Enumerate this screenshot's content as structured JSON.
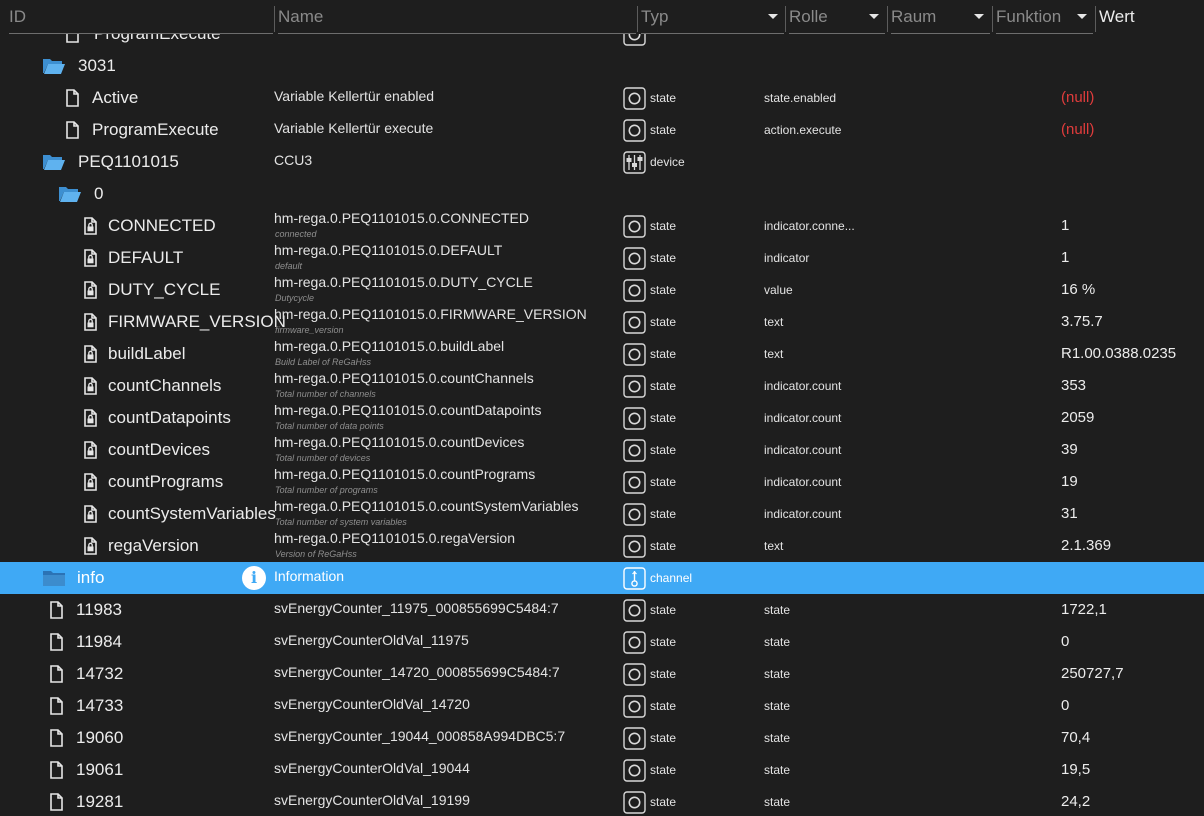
{
  "header": {
    "id": "ID",
    "name": "Name",
    "type": "Typ",
    "role": "Rolle",
    "room": "Raum",
    "function": "Funktion",
    "value": "Wert"
  },
  "colors": {
    "selected": "#3fa9f5",
    "null_value": "#e03c3c",
    "background": "#1e1e1e"
  },
  "rows": [
    {
      "id": "ProgramExecute",
      "name": "",
      "type": "",
      "role": "",
      "value": "",
      "icon": "file-icon"
    },
    {
      "id": "3031",
      "name": "",
      "type": "",
      "role": "",
      "value": "",
      "icon": "folder-open-icon"
    },
    {
      "id": "Active",
      "name": "Variable Kellertür enabled",
      "type": "state",
      "role": "state.enabled",
      "value": "(null)",
      "icon": "file-icon"
    },
    {
      "id": "ProgramExecute",
      "name": "Variable Kellertür execute",
      "type": "state",
      "role": "action.execute",
      "value": "(null)",
      "icon": "file-icon"
    },
    {
      "id": "PEQ1101015",
      "name": "CCU3",
      "type": "device",
      "role": "",
      "value": "",
      "icon": "folder-open-icon"
    },
    {
      "id": "0",
      "name": "",
      "type": "",
      "role": "",
      "value": "",
      "icon": "folder-open-icon"
    },
    {
      "id": "CONNECTED",
      "name": "hm-rega.0.PEQ1101015.0.CONNECTED",
      "desc": "connected",
      "type": "state",
      "role": "indicator.conne...",
      "value": "1",
      "icon": "file-lock-icon"
    },
    {
      "id": "DEFAULT",
      "name": "hm-rega.0.PEQ1101015.0.DEFAULT",
      "desc": "default",
      "type": "state",
      "role": "indicator",
      "value": "1",
      "icon": "file-lock-icon"
    },
    {
      "id": "DUTY_CYCLE",
      "name": "hm-rega.0.PEQ1101015.0.DUTY_CYCLE",
      "desc": "Dutycycle",
      "type": "state",
      "role": "value",
      "value": "16 %",
      "icon": "file-lock-icon"
    },
    {
      "id": "FIRMWARE_VERSION",
      "name": "hm-rega.0.PEQ1101015.0.FIRMWARE_VERSION",
      "desc": "firmware_version",
      "type": "state",
      "role": "text",
      "value": "3.75.7",
      "icon": "file-lock-icon"
    },
    {
      "id": "buildLabel",
      "name": "hm-rega.0.PEQ1101015.0.buildLabel",
      "desc": "Build Label of ReGaHss",
      "type": "state",
      "role": "text",
      "value": "R1.00.0388.0235",
      "icon": "file-lock-icon"
    },
    {
      "id": "countChannels",
      "name": "hm-rega.0.PEQ1101015.0.countChannels",
      "desc": "Total number of channels",
      "type": "state",
      "role": "indicator.count",
      "value": "353",
      "icon": "file-lock-icon"
    },
    {
      "id": "countDatapoints",
      "name": "hm-rega.0.PEQ1101015.0.countDatapoints",
      "desc": "Total number of data points",
      "type": "state",
      "role": "indicator.count",
      "value": "2059",
      "icon": "file-lock-icon"
    },
    {
      "id": "countDevices",
      "name": "hm-rega.0.PEQ1101015.0.countDevices",
      "desc": "Total number of devices",
      "type": "state",
      "role": "indicator.count",
      "value": "39",
      "icon": "file-lock-icon"
    },
    {
      "id": "countPrograms",
      "name": "hm-rega.0.PEQ1101015.0.countPrograms",
      "desc": "Total number of programs",
      "type": "state",
      "role": "indicator.count",
      "value": "19",
      "icon": "file-lock-icon"
    },
    {
      "id": "countSystemVariables",
      "name": "hm-rega.0.PEQ1101015.0.countSystemVariables",
      "desc": "Total number of system variables",
      "type": "state",
      "role": "indicator.count",
      "value": "31",
      "icon": "file-lock-icon"
    },
    {
      "id": "regaVersion",
      "name": "hm-rega.0.PEQ1101015.0.regaVersion",
      "desc": "Version of ReGaHss",
      "type": "state",
      "role": "text",
      "value": "2.1.369",
      "icon": "file-lock-icon"
    },
    {
      "id": "info",
      "name": "Information",
      "type": "channel",
      "role": "",
      "value": "",
      "icon": "folder-icon",
      "badge": "i"
    },
    {
      "id": "11983",
      "name": "svEnergyCounter_11975_000855699C5484:7",
      "type": "state",
      "role": "state",
      "value": "1722,1",
      "icon": "file-icon"
    },
    {
      "id": "11984",
      "name": "svEnergyCounterOldVal_11975",
      "type": "state",
      "role": "state",
      "value": "0",
      "icon": "file-icon"
    },
    {
      "id": "14732",
      "name": "svEnergyCounter_14720_000855699C5484:7",
      "type": "state",
      "role": "state",
      "value": "250727,7",
      "icon": "file-icon"
    },
    {
      "id": "14733",
      "name": "svEnergyCounterOldVal_14720",
      "type": "state",
      "role": "state",
      "value": "0",
      "icon": "file-icon"
    },
    {
      "id": "19060",
      "name": "svEnergyCounter_19044_000858A994DBC5:7",
      "type": "state",
      "role": "state",
      "value": "70,4",
      "icon": "file-icon"
    },
    {
      "id": "19061",
      "name": "svEnergyCounterOldVal_19044",
      "type": "state",
      "role": "state",
      "value": "19,5",
      "icon": "file-icon"
    },
    {
      "id": "19281",
      "name": "svEnergyCounterOldVal_19199",
      "type": "state",
      "role": "state",
      "value": "24,2",
      "icon": "file-icon"
    }
  ]
}
